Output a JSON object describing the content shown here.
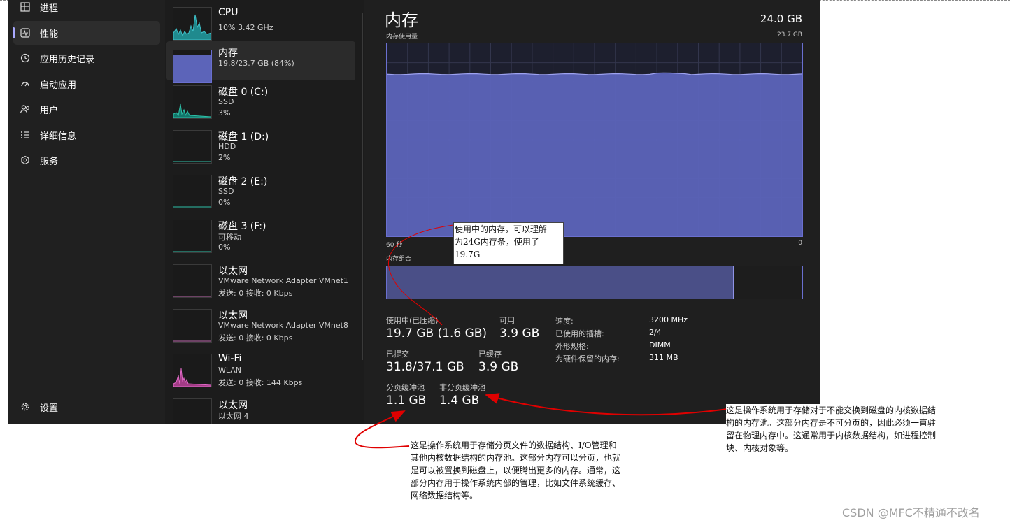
{
  "nav": {
    "items": [
      {
        "icon": "grid-icon",
        "label": "进程"
      },
      {
        "icon": "performance-icon",
        "label": "性能"
      },
      {
        "icon": "history-icon",
        "label": "应用历史记录"
      },
      {
        "icon": "gauge-icon",
        "label": "启动应用"
      },
      {
        "icon": "users-icon",
        "label": "用户"
      },
      {
        "icon": "list-icon",
        "label": "详细信息"
      },
      {
        "icon": "services-icon",
        "label": "服务"
      }
    ],
    "settings": {
      "icon": "gear-icon",
      "label": "设置"
    }
  },
  "devices": [
    {
      "title": "CPU",
      "lines": [
        "10% 3.42 GHz"
      ]
    },
    {
      "title": "内存",
      "lines": [
        "19.8/23.7 GB (84%)"
      ]
    },
    {
      "title": "磁盘 0 (C:)",
      "lines": [
        "SSD",
        "3%"
      ]
    },
    {
      "title": "磁盘 1 (D:)",
      "lines": [
        "HDD",
        "2%"
      ]
    },
    {
      "title": "磁盘 2 (E:)",
      "lines": [
        "SSD",
        "0%"
      ]
    },
    {
      "title": "磁盘 3 (F:)",
      "lines": [
        "可移动",
        "0%"
      ]
    },
    {
      "title": "以太网",
      "lines": [
        "VMware Network Adapter VMnet1",
        "发送: 0 接收: 0 Kbps"
      ]
    },
    {
      "title": "以太网",
      "lines": [
        "VMware Network Adapter VMnet8",
        "发送: 0 接收: 0 Kbps"
      ]
    },
    {
      "title": "Wi-Fi",
      "lines": [
        "WLAN",
        "发送: 0 接收: 144 Kbps"
      ]
    },
    {
      "title": "以太网",
      "lines": [
        "以太网 4"
      ]
    }
  ],
  "main": {
    "title": "内存",
    "total": "24.0 GB",
    "usage_label": "内存使用量",
    "usage_max": "23.7 GB",
    "axis_left": "60 秒",
    "axis_right": "0",
    "composition_label": "内存组合",
    "usage_fraction": 0.84,
    "composition_used_fraction": 0.834,
    "stats": {
      "in_use_label": "使用中(已压缩)",
      "in_use_value": "19.7 GB (1.6 GB)",
      "available_label": "可用",
      "available_value": "3.9 GB",
      "committed_label": "已提交",
      "committed_value": "31.8/37.1 GB",
      "cached_label": "已缓存",
      "cached_value": "3.9 GB",
      "paged_label": "分页缓冲池",
      "paged_value": "1.1 GB",
      "nonpaged_label": "非分页缓冲池",
      "nonpaged_value": "1.4 GB"
    },
    "details": [
      {
        "label": "速度:",
        "value": "3200 MHz"
      },
      {
        "label": "已使用的插槽:",
        "value": "2/4"
      },
      {
        "label": "外形规格:",
        "value": "DIMM"
      },
      {
        "label": "为硬件保留的内存:",
        "value": "311 MB"
      }
    ]
  },
  "annotations": {
    "in_use": "使用中的内存，可以理解\n为24G内存条，使用了\n19.7G",
    "nonpaged": "这是操作系统用于存储对于不能交换到磁盘的内核数据结\n构的内存池。这部分内存是不可分页的，因此必须一直驻\n留在物理内存中。这通常用于内核数据结构，如进程控制\n块、内核对象等。",
    "paged": "这是操作系统用于存储分页文件的数据结构、I/O管理和\n其他内核数据结构的内存池。这部分内存可以分页，也就\n是可以被置换到磁盘上，以便腾出更多的内存。通常，这\n部分内存用于操作系统内部的管理，比如文件系统缓存、\n网络数据结构等。"
  },
  "watermark": "CSDN @MFC不精通不改名",
  "colors": {
    "accent": "#6a6fcf",
    "graph_fill": "#5c64b9",
    "annotation_arrow": "#e00000"
  }
}
